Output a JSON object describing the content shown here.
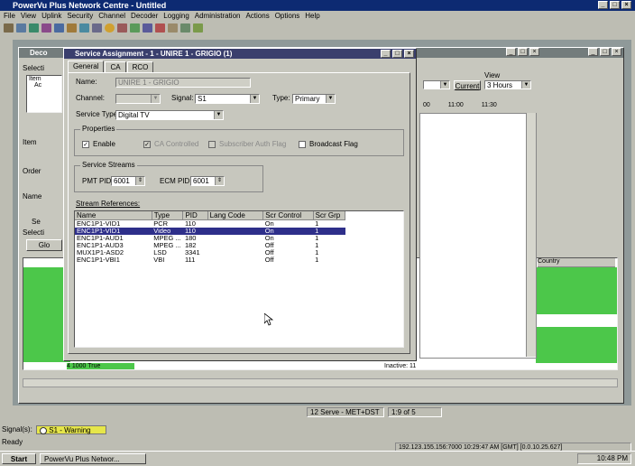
{
  "app": {
    "title": "PowerVu Plus Network Centre - Untitled",
    "menu": [
      "File",
      "View",
      "Uplink",
      "Security",
      "Channel",
      "Decoder",
      "Logging",
      "Administration",
      "Actions",
      "Options",
      "Help"
    ]
  },
  "colors": {
    "title_active": "#0d2a72",
    "selection": "#2e2f8a",
    "status_green": "#4cc74a",
    "warning_yellow": "#e6e64a"
  },
  "bg_window": {
    "title": "Deco",
    "partial_labels": {
      "select_top": "Selecti",
      "item": "Item",
      "ac": "Ac",
      "item2": "Item",
      "order": "Order",
      "name": "Name",
      "se": "Se",
      "select2": "Selecti",
      "glo": "Glo"
    },
    "view_label": "View",
    "current_label": "Current",
    "hours_value": "3 Hours",
    "times": [
      "00",
      "11:00",
      "11:30"
    ],
    "country_header": "Country",
    "row_tail": "4 1000  True",
    "row_tail2": "Inactive: 11",
    "status_cells": [
      "12  Serve - MET+DST",
      "1:9 of 5"
    ]
  },
  "dialog": {
    "title": "Service Assignment - 1 - UNIRE 1 - GRIGIO (1)",
    "tabs": [
      "General",
      "CA",
      "RCO"
    ],
    "name_label": "Name:",
    "name_value": "UNIRE 1 - GRIGIO",
    "channel_label": "Channel:",
    "channel_value": "",
    "signal_label": "Signal:",
    "signal_value": "S1",
    "type_label": "Type:",
    "type_value": "Primary",
    "service_type_label": "Service Type:",
    "service_type_value": "Digital TV",
    "properties_label": "Properties",
    "enable_label": "Enable",
    "ca_label": "CA Controlled",
    "sa_label": "Subscriber Auth Flag",
    "broadcast_label": "Broadcast Flag",
    "service_streams_label": "Service Streams",
    "pmt_label": "PMT PID:",
    "pmt_value": "6001",
    "ecm_label": "ECM PID:",
    "ecm_value": "6001",
    "stream_refs_label": "Stream References:",
    "columns": [
      "Name",
      "Type",
      "PID",
      "Lang Code",
      "Scr Control",
      "Scr Grp"
    ],
    "rows": [
      {
        "name": "ENC1P1-VID1",
        "type": "PCR",
        "pid": "110",
        "lang": "",
        "scr": "On",
        "grp": "1"
      },
      {
        "name": "ENC1P1-VID1",
        "type": "Video",
        "pid": "110",
        "lang": "",
        "scr": "On",
        "grp": "1"
      },
      {
        "name": "ENC1P1-AUD1",
        "type": "MPEG ...",
        "pid": "180",
        "lang": "",
        "scr": "On",
        "grp": "1"
      },
      {
        "name": "ENC1P1-AUD3",
        "type": "MPEG ...",
        "pid": "182",
        "lang": "",
        "scr": "Off",
        "grp": "1"
      },
      {
        "name": "MUX1P1-ASD2",
        "type": "LSD",
        "pid": "3341",
        "lang": "",
        "scr": "Off",
        "grp": "1"
      },
      {
        "name": "ENC1P1-VBI1",
        "type": "VBI",
        "pid": "111",
        "lang": "",
        "scr": "Off",
        "grp": "1"
      }
    ]
  },
  "status": {
    "signal_label": "Signal(s):",
    "signal_value": "S1 - Warning",
    "ready": "Ready",
    "address": "192.123.155.156:7000 10:29:47 AM [GMT] [0.0.10.25.627]"
  },
  "taskbar": {
    "start": "Start",
    "task": "PowerVu Plus Networ...",
    "clock": "10:48 PM"
  }
}
